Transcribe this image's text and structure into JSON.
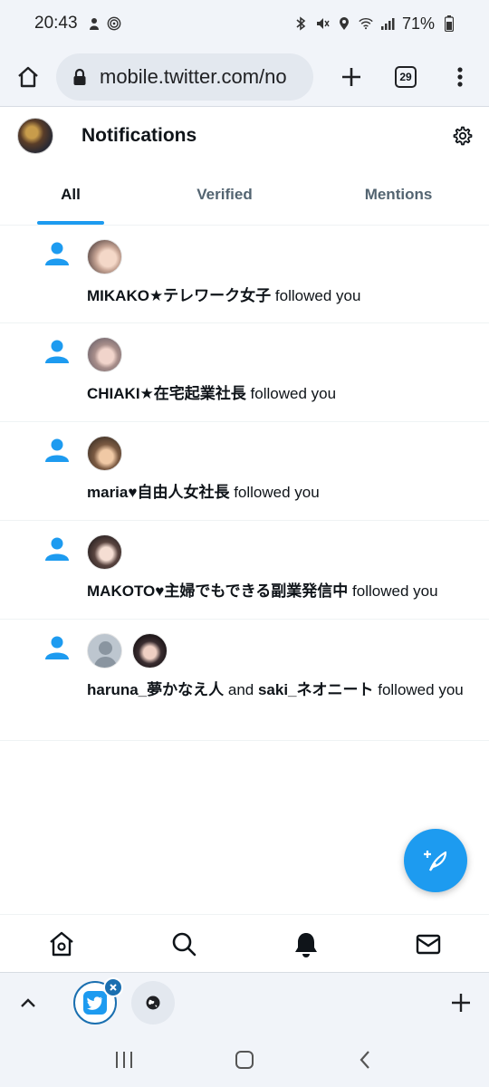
{
  "status_bar": {
    "time": "20:43",
    "battery": "71%"
  },
  "browser": {
    "url": "mobile.twitter.com/no",
    "tab_count": "29"
  },
  "header": {
    "title": "Notifications"
  },
  "tabs": [
    {
      "label": "All"
    },
    {
      "label": "Verified"
    },
    {
      "label": "Mentions"
    }
  ],
  "notifications": [
    {
      "user": "MIKAKO★テレワーク女子",
      "action": " followed you"
    },
    {
      "user": "CHIAKI★在宅起業社長",
      "action": " followed you"
    },
    {
      "user": "maria♥自由人女社長",
      "action": " followed you"
    },
    {
      "user": "MAKOTO♥主婦でもできる副業発信中",
      "action": " followed you"
    },
    {
      "user": "haruna_夢かなえ人",
      "conjunction": " and ",
      "user2": "saki_ネオニート",
      "action": " followed you"
    }
  ],
  "colors": {
    "accent": "#1d9bf0",
    "text": "#0f1419",
    "muted": "#536471"
  }
}
